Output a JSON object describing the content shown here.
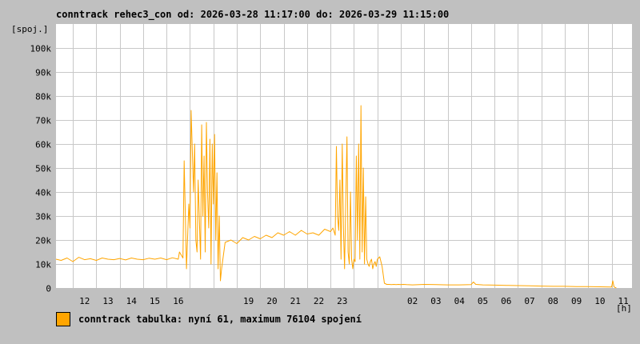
{
  "colors": {
    "background": "#c0c0c0",
    "plot_background": "#ffffff",
    "grid": "#c8c8c8",
    "series": "#ffa500"
  },
  "chart_data": {
    "type": "line",
    "title": "conntrack rehec3_con od: 2026-03-28 11:17:00 do: 2026-03-29 11:15:00",
    "ylabel": "[spoj.]",
    "xlabel": "[h]",
    "ylim": [
      0,
      110000
    ],
    "xlim": [
      11.28,
      35.87
    ],
    "grid": true,
    "y_ticks": [
      {
        "value": 0,
        "label": "0"
      },
      {
        "value": 10000,
        "label": "10k"
      },
      {
        "value": 20000,
        "label": "20k"
      },
      {
        "value": 30000,
        "label": "30k"
      },
      {
        "value": 40000,
        "label": "40k"
      },
      {
        "value": 50000,
        "label": "50k"
      },
      {
        "value": 60000,
        "label": "60k"
      },
      {
        "value": 70000,
        "label": "70k"
      },
      {
        "value": 80000,
        "label": "80k"
      },
      {
        "value": 90000,
        "label": "90k"
      },
      {
        "value": 100000,
        "label": "100k"
      }
    ],
    "x_ticks": [
      {
        "value": 12,
        "label": "12"
      },
      {
        "value": 13,
        "label": "13"
      },
      {
        "value": 14,
        "label": "14"
      },
      {
        "value": 15,
        "label": "15"
      },
      {
        "value": 16,
        "label": "16"
      },
      {
        "value": 19,
        "label": "19"
      },
      {
        "value": 20,
        "label": "20"
      },
      {
        "value": 21,
        "label": "21"
      },
      {
        "value": 22,
        "label": "22"
      },
      {
        "value": 23,
        "label": "23"
      },
      {
        "value": 26,
        "label": "02"
      },
      {
        "value": 27,
        "label": "03"
      },
      {
        "value": 28,
        "label": "04"
      },
      {
        "value": 29,
        "label": "05"
      },
      {
        "value": 30,
        "label": "06"
      },
      {
        "value": 31,
        "label": "07"
      },
      {
        "value": 32,
        "label": "08"
      },
      {
        "value": 33,
        "label": "09"
      },
      {
        "value": 34,
        "label": "10"
      },
      {
        "value": 35,
        "label": "11"
      }
    ],
    "x_grid": [
      12,
      13,
      14,
      15,
      16,
      17,
      18,
      19,
      20,
      21,
      22,
      23,
      24,
      25,
      26,
      27,
      28,
      29,
      30,
      31,
      32,
      33,
      34,
      35
    ],
    "series": [
      {
        "name": "conntrack tabulka",
        "color": "#ffa500",
        "x": [
          11.28,
          11.5,
          11.75,
          12.0,
          12.25,
          12.5,
          12.75,
          13.0,
          13.25,
          13.5,
          13.75,
          14.0,
          14.25,
          14.5,
          14.75,
          15.0,
          15.25,
          15.5,
          15.75,
          16.0,
          16.25,
          16.5,
          16.55,
          16.7,
          16.75,
          16.85,
          16.95,
          17.0,
          17.05,
          17.15,
          17.2,
          17.25,
          17.3,
          17.35,
          17.45,
          17.5,
          17.55,
          17.6,
          17.65,
          17.7,
          17.75,
          17.8,
          17.85,
          17.9,
          17.95,
          18.0,
          18.05,
          18.1,
          18.15,
          18.2,
          18.25,
          18.3,
          18.35,
          18.5,
          18.75,
          19.0,
          19.25,
          19.5,
          19.75,
          20.0,
          20.25,
          20.5,
          20.75,
          21.0,
          21.25,
          21.5,
          21.75,
          22.0,
          22.25,
          22.5,
          22.75,
          23.0,
          23.1,
          23.2,
          23.25,
          23.3,
          23.35,
          23.4,
          23.45,
          23.5,
          23.55,
          23.6,
          23.65,
          23.7,
          23.75,
          23.8,
          23.85,
          23.9,
          23.95,
          24.0,
          24.05,
          24.1,
          24.15,
          24.2,
          24.25,
          24.3,
          24.35,
          24.4,
          24.45,
          24.5,
          24.55,
          24.6,
          24.65,
          24.7,
          24.75,
          24.8,
          24.85,
          24.9,
          24.95,
          25.0,
          25.1,
          25.2,
          25.3,
          25.4,
          25.5,
          25.6,
          25.7,
          25.8,
          25.9,
          26.0,
          26.1,
          26.25,
          26.5,
          27.0,
          27.5,
          28.0,
          28.5,
          29.0,
          29.1,
          29.2,
          29.5,
          30.0,
          30.5,
          31.0,
          31.5,
          32.0,
          32.5,
          33.0,
          33.5,
          34.0,
          34.5,
          35.0,
          35.05,
          35.1,
          35.15,
          35.2
        ],
        "values": [
          12000,
          11500,
          12500,
          11000,
          12800,
          11800,
          12200,
          11500,
          12500,
          12000,
          11800,
          12300,
          11700,
          12500,
          12000,
          11800,
          12400,
          12000,
          12500,
          11800,
          12600,
          12000,
          15000,
          12500,
          53000,
          8000,
          35000,
          25000,
          74000,
          40000,
          60000,
          20000,
          15000,
          45000,
          12000,
          68000,
          30000,
          55000,
          15000,
          69000,
          40000,
          25000,
          62000,
          10000,
          60000,
          35000,
          64000,
          20000,
          48000,
          8000,
          30000,
          3000,
          8000,
          19000,
          20000,
          18500,
          21000,
          20000,
          21500,
          20500,
          22000,
          21000,
          23000,
          22000,
          23500,
          22000,
          24000,
          22500,
          23000,
          22000,
          24500,
          23500,
          25000,
          22000,
          59000,
          30000,
          24000,
          45000,
          12000,
          60000,
          25000,
          8000,
          36000,
          63000,
          15000,
          10000,
          40000,
          12000,
          8000,
          12000,
          11000,
          55000,
          20000,
          60000,
          12000,
          76000,
          15000,
          50000,
          10000,
          38000,
          12000,
          10000,
          9000,
          11000,
          12000,
          8000,
          10000,
          11000,
          9000,
          12000,
          13000,
          9000,
          2000,
          1500,
          1500,
          1400,
          1500,
          1400,
          1500,
          1400,
          1500,
          1400,
          1300,
          1500,
          1400,
          1300,
          1300,
          1400,
          2500,
          1500,
          1300,
          1200,
          1100,
          1000,
          900,
          800,
          700,
          700,
          600,
          600,
          500,
          400,
          3000,
          500,
          200,
          61
        ]
      }
    ],
    "legend": {
      "label": "conntrack tabulka: nyní 61, maximum 76104 spojení",
      "placement": "bottom-left"
    }
  }
}
